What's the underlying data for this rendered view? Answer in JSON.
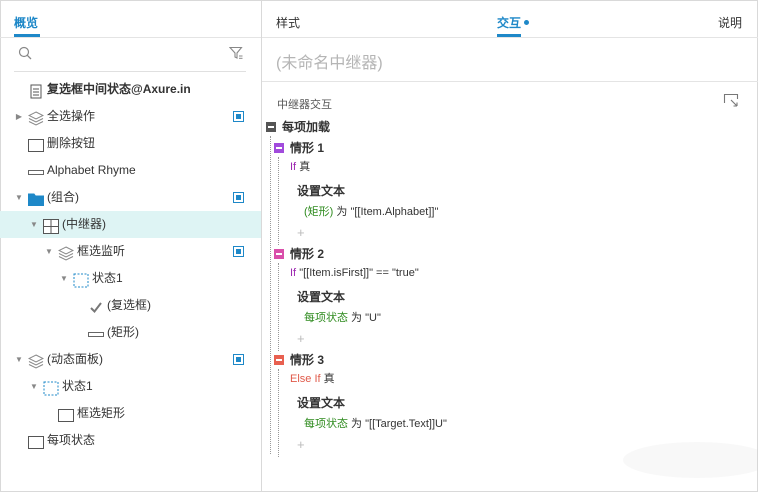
{
  "left_panel": {
    "tab": "概览",
    "tree": [
      {
        "label": "复选框中间状态@Axure.in",
        "icon": "page-icon",
        "arrow": "",
        "bold": true,
        "marked": false,
        "selected": false,
        "indent": 0
      },
      {
        "label": "全选操作",
        "icon": "layers-icon",
        "arrow": "▶",
        "bold": false,
        "marked": true,
        "selected": false,
        "indent": 0
      },
      {
        "label": "删除按钮",
        "icon": "rectangle-icon",
        "arrow": "",
        "bold": false,
        "marked": false,
        "selected": false,
        "indent": 0
      },
      {
        "label": "Alphabet Rhyme",
        "icon": "text-line-icon",
        "arrow": "",
        "bold": false,
        "marked": false,
        "selected": false,
        "indent": 0
      },
      {
        "label": "(组合)",
        "icon": "folder-icon",
        "arrow": "▼",
        "bold": false,
        "marked": true,
        "selected": false,
        "indent": 0
      },
      {
        "label": "(中继器)",
        "icon": "repeater-grid-icon",
        "arrow": "▼",
        "bold": false,
        "marked": false,
        "selected": true,
        "indent": 1
      },
      {
        "label": "框选监听",
        "icon": "layers-icon",
        "arrow": "▼",
        "bold": false,
        "marked": true,
        "selected": false,
        "indent": 2
      },
      {
        "label": "状态1",
        "icon": "dashed-state-icon",
        "arrow": "▼",
        "bold": false,
        "marked": false,
        "selected": false,
        "indent": 3
      },
      {
        "label": "(复选框)",
        "icon": "checkmark-icon",
        "arrow": "",
        "bold": false,
        "marked": false,
        "selected": false,
        "indent": 4
      },
      {
        "label": "(矩形)",
        "icon": "text-line-icon",
        "arrow": "",
        "bold": false,
        "marked": false,
        "selected": false,
        "indent": 4
      },
      {
        "label": "(动态面板)",
        "icon": "layers-icon",
        "arrow": "▼",
        "bold": false,
        "marked": true,
        "selected": false,
        "indent": 0
      },
      {
        "label": "状态1",
        "icon": "dashed-state-icon",
        "arrow": "▼",
        "bold": false,
        "marked": false,
        "selected": false,
        "indent": 1
      },
      {
        "label": "框选矩形",
        "icon": "rectangle-icon",
        "arrow": "",
        "bold": false,
        "marked": false,
        "selected": false,
        "indent": 2
      },
      {
        "label": "每项状态",
        "icon": "rectangle-icon",
        "arrow": "",
        "bold": false,
        "marked": false,
        "selected": false,
        "indent": 0
      }
    ]
  },
  "right_panel": {
    "tabs": {
      "style": "样式",
      "interaction": "交互",
      "notes": "说明"
    },
    "widget_name_placeholder": "(未命名中继器)",
    "section_title": "中继器交互",
    "event": "每项加载",
    "cases": [
      {
        "name": "情形 1",
        "color": "#a14bdc",
        "cond_kw": "If",
        "cond_rest": "真",
        "action": "设置文本",
        "target": "(矩形)",
        "to": " 为 \"[[Item.Alphabet]]\""
      },
      {
        "name": "情形 2",
        "color": "#d94faa",
        "cond_kw": "If",
        "cond_rest": "\"[[Item.isFirst]]\" == \"true\"",
        "action": "设置文本",
        "target": "每项状态",
        "to": " 为 \"U\""
      },
      {
        "name": "情形 3",
        "color": "#e86050",
        "cond_kw": "Else If",
        "cond_rest": "真",
        "action": "设置文本",
        "target": "每项状态",
        "to": " 为 \"[[Target.Text]]U\""
      }
    ],
    "plus_symbol": "+"
  },
  "colors": {
    "accent": "#1e88c8",
    "selected_row": "#def4f4",
    "event_box": "#555555",
    "target_green": "#2e8b1e"
  }
}
